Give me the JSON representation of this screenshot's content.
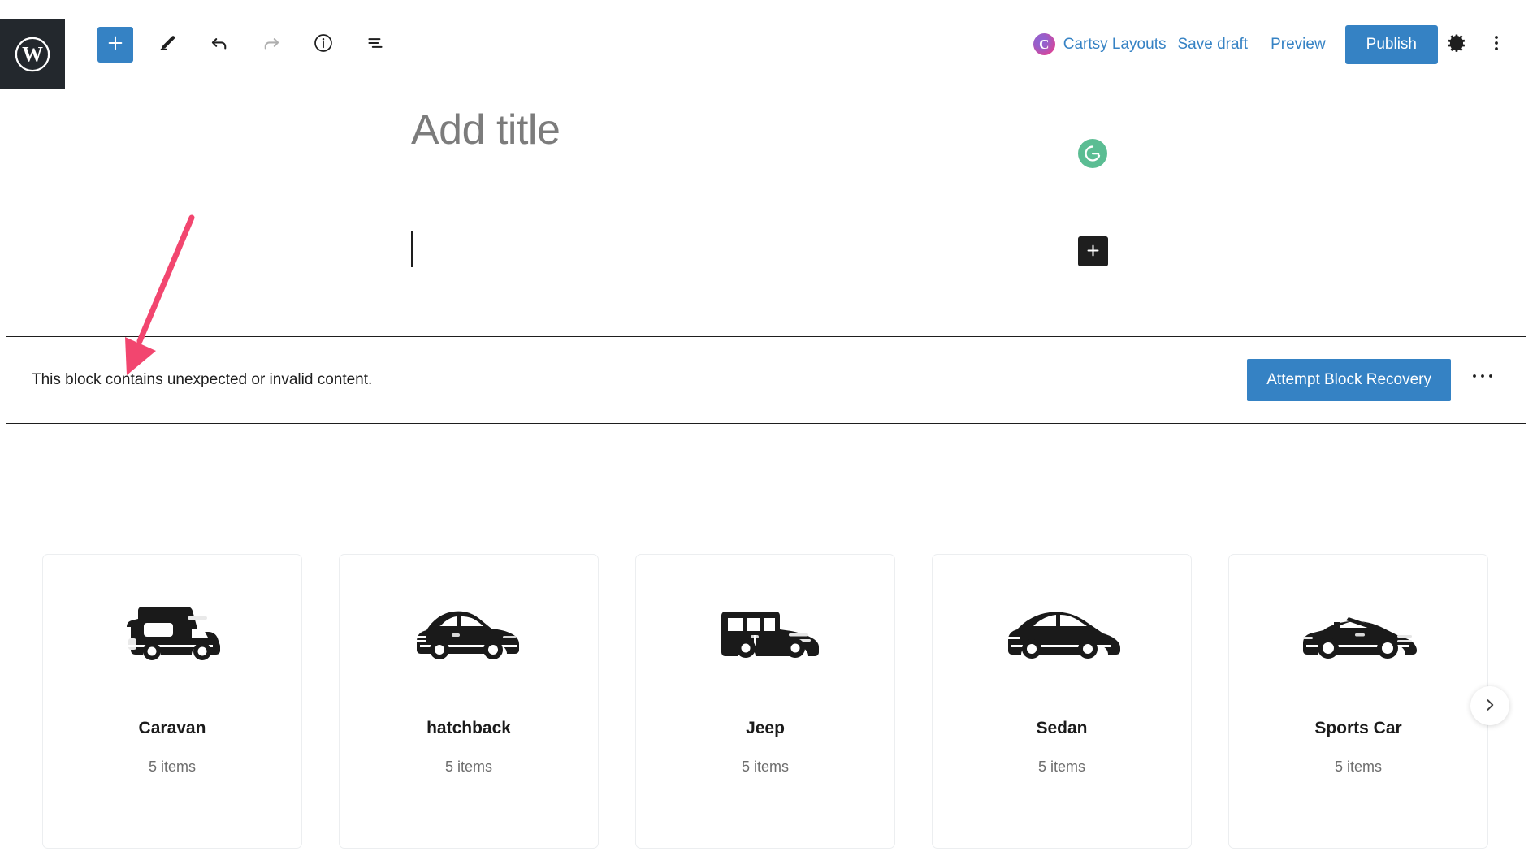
{
  "header": {
    "logo_icon": "wordpress-logo-icon",
    "tools": [
      {
        "name": "add-block-button",
        "icon": "plus-icon",
        "label": "Add block"
      },
      {
        "name": "edit-mode-button",
        "icon": "pencil-icon",
        "label": "Edit"
      },
      {
        "name": "undo-button",
        "icon": "undo-arrow-icon",
        "label": "Undo"
      },
      {
        "name": "redo-button",
        "icon": "redo-arrow-icon",
        "label": "Redo"
      },
      {
        "name": "details-button",
        "icon": "info-circle-icon",
        "label": "Details"
      },
      {
        "name": "list-view-button",
        "icon": "document-outline-icon",
        "label": "List view"
      }
    ],
    "cartsy_layouts_label": "Cartsy Layouts",
    "save_draft_label": "Save draft",
    "preview_label": "Preview",
    "publish_label": "Publish",
    "settings_icon": "gear-icon",
    "more_options_icon": "kebab-menu-icon"
  },
  "editor": {
    "title_placeholder": "Add title",
    "grammarly_icon": "grammarly-g-icon",
    "block_inserter_icon": "plus-icon"
  },
  "invalid_block": {
    "message": "This block contains unexpected or invalid content.",
    "recovery_button_label": "Attempt Block Recovery",
    "more_icon": "ellipsis-horizontal-icon"
  },
  "carousel": {
    "next_icon": "chevron-right-icon",
    "cards": [
      {
        "name": "Caravan",
        "count": "5 items",
        "icon": "caravan-icon"
      },
      {
        "name": "hatchback",
        "count": "5 items",
        "icon": "hatchback-car-icon"
      },
      {
        "name": "Jeep",
        "count": "5 items",
        "icon": "jeep-suv-icon"
      },
      {
        "name": "Sedan",
        "count": "5 items",
        "icon": "sedan-car-icon"
      },
      {
        "name": "Sports Car",
        "count": "5 items",
        "icon": "convertible-sports-car-icon"
      }
    ]
  },
  "annotation": {
    "type": "arrow",
    "color": "#f2466f"
  },
  "colors": {
    "accent_blue": "#3582c4",
    "admin_dark": "#23282d",
    "annotation_pink": "#f2466f",
    "grammarly_green": "#5bbd93",
    "card_border": "#eceef0"
  }
}
